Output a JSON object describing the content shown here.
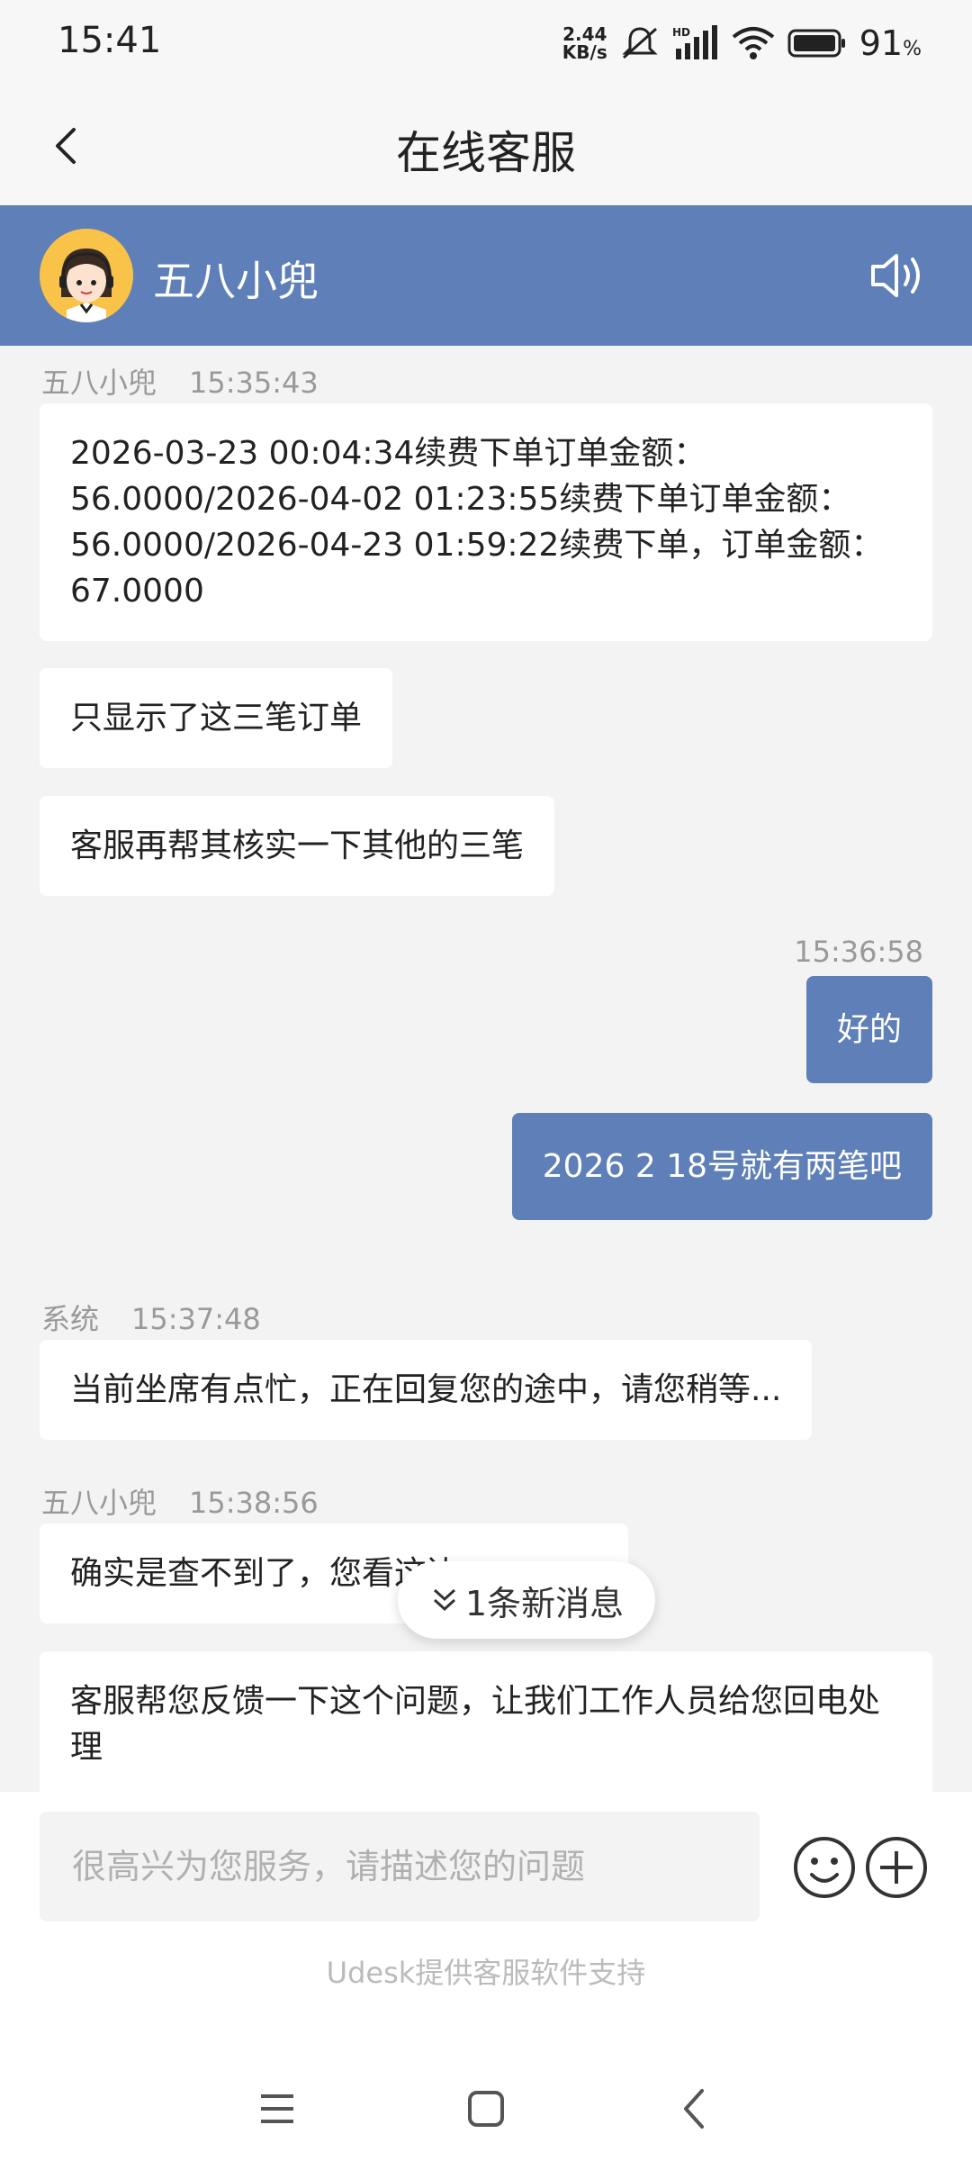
{
  "status": {
    "time": "15:41",
    "speed_top": "2.44",
    "speed_bottom": "KB/s",
    "network": "HD",
    "battery": "91",
    "battery_unit": "%"
  },
  "header": {
    "title": "在线客服"
  },
  "agent": {
    "name": "五八小兜"
  },
  "messages": {
    "m1_meta_name": "五八小兜",
    "m1_meta_time": "15:35:43",
    "m1_text": "2026-03-23 00:04:34续费下单订单金额：56.0000/2026-04-02 01:23:55续费下单订单金额：56.0000/2026-04-23 01:59:22续费下单，订单金额：67.0000",
    "m2_text": "只显示了这三笔订单",
    "m3_text": "客服再帮其核实一下其他的三笔",
    "m4_meta_time": "15:36:58",
    "m4_text": "好的",
    "m5_text": "2026 2 18号就有两笔吧",
    "m6_meta_name": "系统",
    "m6_meta_time": "15:37:48",
    "m6_text": "当前坐席有点忙，正在回复您的途中，请您稍等...",
    "m7_meta_name": "五八小兜",
    "m7_meta_time": "15:38:56",
    "m7_text": "确实是查不到了，您看这边",
    "m8_text": "客服帮您反馈一下这个问题，让我们工作人员给您回电处理"
  },
  "new_message_pill": "1条新消息",
  "composer": {
    "placeholder": "很高兴为您服务，请描述您的问题",
    "powered_by": "Udesk提供客服软件支持"
  },
  "colors": {
    "accent": "#5e7fb7",
    "background": "#f3f3f3",
    "bubble_other": "#ffffff"
  }
}
